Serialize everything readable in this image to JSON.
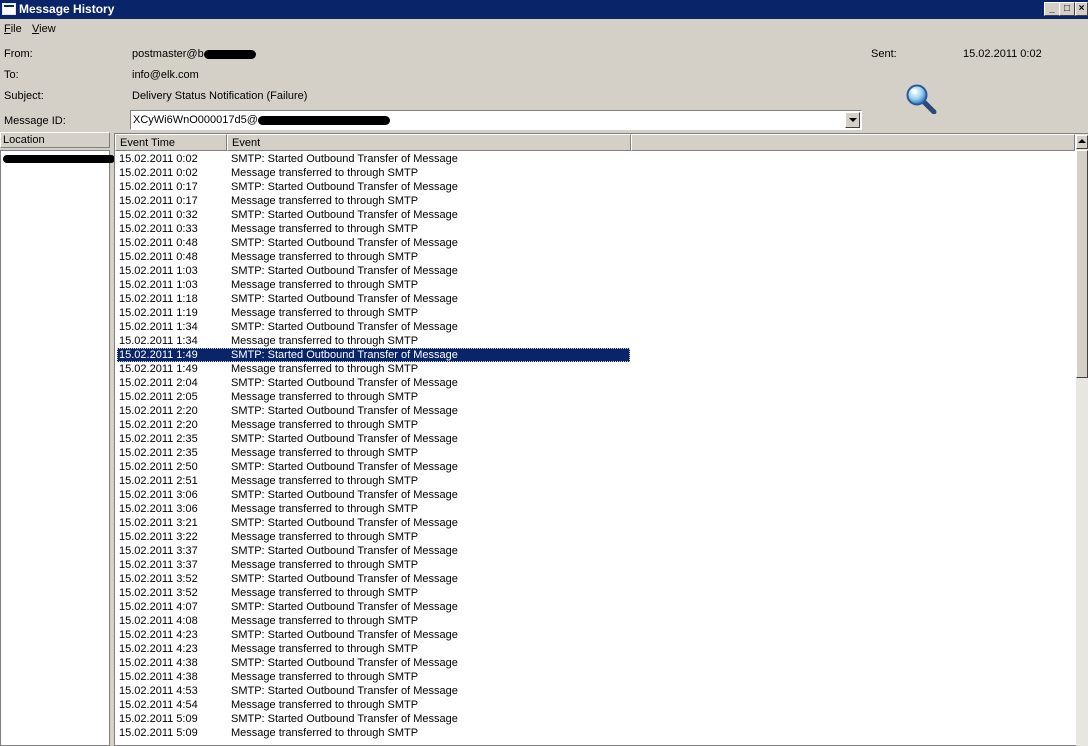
{
  "window": {
    "title": "Message History"
  },
  "menu": {
    "file": "File",
    "file_key": "F",
    "file_rest": "ile",
    "view_key": "V",
    "view_rest": "iew"
  },
  "header": {
    "from_label": "From:",
    "from_value": "postmaster@b",
    "to_label": "To:",
    "to_value": "info@elk.com",
    "subject_label": "Subject:",
    "subject_value": "Delivery Status Notification (Failure)",
    "messageid_label": "Message ID:",
    "messageid_value": "XCyWi6WnO000017d5@",
    "sent_label": "Sent:",
    "sent_value": "15.02.2011  0:02"
  },
  "location": {
    "header": "Location"
  },
  "list": {
    "columns": [
      "Event Time",
      "Event"
    ],
    "selected_index": 14,
    "rows": [
      {
        "time": "15.02.2011  0:02",
        "event": "SMTP: Started Outbound Transfer of Message"
      },
      {
        "time": "15.02.2011  0:02",
        "event": "Message transferred to  through SMTP"
      },
      {
        "time": "15.02.2011  0:17",
        "event": "SMTP: Started Outbound Transfer of Message"
      },
      {
        "time": "15.02.2011  0:17",
        "event": "Message transferred to  through SMTP"
      },
      {
        "time": "15.02.2011  0:32",
        "event": "SMTP: Started Outbound Transfer of Message"
      },
      {
        "time": "15.02.2011  0:33",
        "event": "Message transferred to  through SMTP"
      },
      {
        "time": "15.02.2011  0:48",
        "event": "SMTP: Started Outbound Transfer of Message"
      },
      {
        "time": "15.02.2011  0:48",
        "event": "Message transferred to  through SMTP"
      },
      {
        "time": "15.02.2011  1:03",
        "event": "SMTP: Started Outbound Transfer of Message"
      },
      {
        "time": "15.02.2011  1:03",
        "event": "Message transferred to  through SMTP"
      },
      {
        "time": "15.02.2011  1:18",
        "event": "SMTP: Started Outbound Transfer of Message"
      },
      {
        "time": "15.02.2011  1:19",
        "event": "Message transferred to  through SMTP"
      },
      {
        "time": "15.02.2011  1:34",
        "event": "SMTP: Started Outbound Transfer of Message"
      },
      {
        "time": "15.02.2011  1:34",
        "event": "Message transferred to  through SMTP"
      },
      {
        "time": "15.02.2011  1:49",
        "event": "SMTP: Started Outbound Transfer of Message"
      },
      {
        "time": "15.02.2011  1:49",
        "event": "Message transferred to  through SMTP"
      },
      {
        "time": "15.02.2011  2:04",
        "event": "SMTP: Started Outbound Transfer of Message"
      },
      {
        "time": "15.02.2011  2:05",
        "event": "Message transferred to  through SMTP"
      },
      {
        "time": "15.02.2011  2:20",
        "event": "SMTP: Started Outbound Transfer of Message"
      },
      {
        "time": "15.02.2011  2:20",
        "event": "Message transferred to  through SMTP"
      },
      {
        "time": "15.02.2011  2:35",
        "event": "SMTP: Started Outbound Transfer of Message"
      },
      {
        "time": "15.02.2011  2:35",
        "event": "Message transferred to  through SMTP"
      },
      {
        "time": "15.02.2011  2:50",
        "event": "SMTP: Started Outbound Transfer of Message"
      },
      {
        "time": "15.02.2011  2:51",
        "event": "Message transferred to  through SMTP"
      },
      {
        "time": "15.02.2011  3:06",
        "event": "SMTP: Started Outbound Transfer of Message"
      },
      {
        "time": "15.02.2011  3:06",
        "event": "Message transferred to  through SMTP"
      },
      {
        "time": "15.02.2011  3:21",
        "event": "SMTP: Started Outbound Transfer of Message"
      },
      {
        "time": "15.02.2011  3:22",
        "event": "Message transferred to  through SMTP"
      },
      {
        "time": "15.02.2011  3:37",
        "event": "SMTP: Started Outbound Transfer of Message"
      },
      {
        "time": "15.02.2011  3:37",
        "event": "Message transferred to  through SMTP"
      },
      {
        "time": "15.02.2011  3:52",
        "event": "SMTP: Started Outbound Transfer of Message"
      },
      {
        "time": "15.02.2011  3:52",
        "event": "Message transferred to  through SMTP"
      },
      {
        "time": "15.02.2011  4:07",
        "event": "SMTP: Started Outbound Transfer of Message"
      },
      {
        "time": "15.02.2011  4:08",
        "event": "Message transferred to  through SMTP"
      },
      {
        "time": "15.02.2011  4:23",
        "event": "SMTP: Started Outbound Transfer of Message"
      },
      {
        "time": "15.02.2011  4:23",
        "event": "Message transferred to  through SMTP"
      },
      {
        "time": "15.02.2011  4:38",
        "event": "SMTP: Started Outbound Transfer of Message"
      },
      {
        "time": "15.02.2011  4:38",
        "event": "Message transferred to  through SMTP"
      },
      {
        "time": "15.02.2011  4:53",
        "event": "SMTP: Started Outbound Transfer of Message"
      },
      {
        "time": "15.02.2011  4:54",
        "event": "Message transferred to  through SMTP"
      },
      {
        "time": "15.02.2011  5:09",
        "event": "SMTP: Started Outbound Transfer of Message"
      },
      {
        "time": "15.02.2011  5:09",
        "event": "Message transferred to  through SMTP"
      }
    ]
  },
  "icons": {
    "search": "magnifier-icon",
    "app": "window-icon",
    "dropdown": "dropdown-arrow-icon"
  },
  "colors": {
    "titlebar": "#0a246a",
    "selection": "#0a246a",
    "window": "#d4d0c8"
  }
}
